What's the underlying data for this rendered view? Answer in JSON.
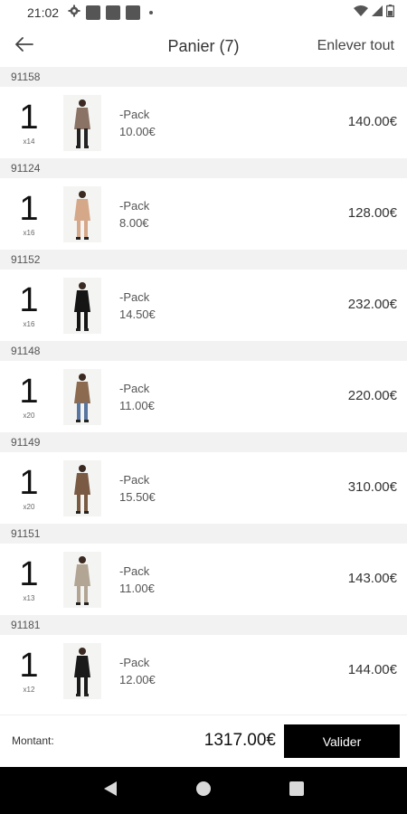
{
  "status": {
    "time": "21:02"
  },
  "appbar": {
    "title": "Panier (7)",
    "clear_all": "Enlever tout"
  },
  "cart": [
    {
      "group": "91158",
      "qty": "1",
      "qty_sub": "x14",
      "label": "-Pack",
      "unit_price": "10.00€",
      "total": "140.00€",
      "outfit_color": "#8a7265",
      "legs_color": "#222222"
    },
    {
      "group": "91124",
      "qty": "1",
      "qty_sub": "x16",
      "label": "-Pack",
      "unit_price": "8.00€",
      "total": "128.00€",
      "outfit_color": "#d6a88a",
      "legs_color": "#d6a88a"
    },
    {
      "group": "91152",
      "qty": "1",
      "qty_sub": "x16",
      "label": "-Pack",
      "unit_price": "14.50€",
      "total": "232.00€",
      "outfit_color": "#151515",
      "legs_color": "#151515"
    },
    {
      "group": "91148",
      "qty": "1",
      "qty_sub": "x20",
      "label": "-Pack",
      "unit_price": "11.00€",
      "total": "220.00€",
      "outfit_color": "#8c6a4f",
      "legs_color": "#5876a0"
    },
    {
      "group": "91149",
      "qty": "1",
      "qty_sub": "x20",
      "label": "-Pack",
      "unit_price": "15.50€",
      "total": "310.00€",
      "outfit_color": "#7a5a43",
      "legs_color": "#7a5a43"
    },
    {
      "group": "91151",
      "qty": "1",
      "qty_sub": "x13",
      "label": "-Pack",
      "unit_price": "11.00€",
      "total": "143.00€",
      "outfit_color": "#b3a594",
      "legs_color": "#b3a594"
    },
    {
      "group": "91181",
      "qty": "1",
      "qty_sub": "x12",
      "label": "-Pack",
      "unit_price": "12.00€",
      "total": "144.00€",
      "outfit_color": "#1a1a1a",
      "legs_color": "#1a1a1a"
    }
  ],
  "footer": {
    "amount_label": "Montant:",
    "amount_value": "1317.00€",
    "validate_label": "Valider"
  },
  "colors": {
    "accent": "#000000",
    "group_bg": "#f2f2f2"
  }
}
